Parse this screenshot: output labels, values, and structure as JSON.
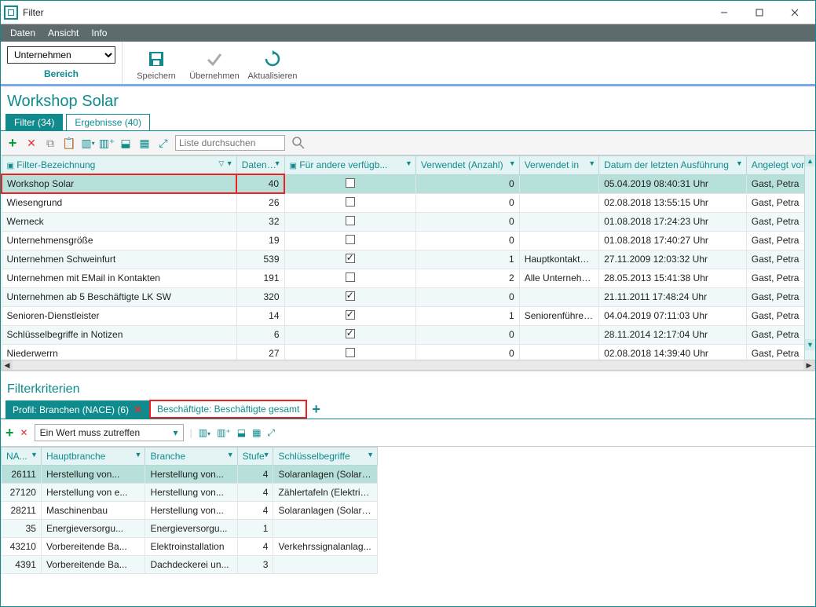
{
  "window": {
    "title": "Filter"
  },
  "menubar": {
    "items": [
      "Daten",
      "Ansicht",
      "Info"
    ]
  },
  "toolbar": {
    "area_selected": "Unternehmen",
    "area_label": "Bereich",
    "buttons": {
      "save": "Speichern",
      "apply": "Übernehmen",
      "refresh": "Aktualisieren"
    }
  },
  "page_title": "Workshop Solar",
  "tabs": {
    "filter": "Filter (34)",
    "results": "Ergebnisse (40)"
  },
  "list_toolbar": {
    "search_placeholder": "Liste durchsuchen"
  },
  "grid": {
    "columns": {
      "name": "Filter-Bezeichnung",
      "datasets": "Datensät...",
      "share": "Für andere verfügb...",
      "used_count": "Verwendet (Anzahl)",
      "used_in": "Verwendet in",
      "last_run": "Datum der letzten Ausführung",
      "created_by": "Angelegt von"
    },
    "rows": [
      {
        "name": "Workshop Solar",
        "count": "40",
        "share": false,
        "used": "0",
        "used_in": "",
        "date": "05.04.2019 08:40:31 Uhr",
        "by": "Gast, Petra",
        "selected": true,
        "highlight": true
      },
      {
        "name": "Wiesengrund",
        "count": "26",
        "share": false,
        "used": "0",
        "used_in": "",
        "date": "02.08.2018 13:55:15 Uhr",
        "by": "Gast, Petra"
      },
      {
        "name": "Werneck",
        "count": "32",
        "share": false,
        "used": "0",
        "used_in": "",
        "date": "01.08.2018 17:24:23 Uhr",
        "by": "Gast, Petra"
      },
      {
        "name": "Unternehmensgröße",
        "count": "19",
        "share": false,
        "used": "0",
        "used_in": "",
        "date": "01.08.2018 17:40:27 Uhr",
        "by": "Gast, Petra"
      },
      {
        "name": "Unternehmen Schweinfurt",
        "count": "539",
        "share": true,
        "used": "1",
        "used_in": "Hauptkontakte S...",
        "date": "27.11.2009 12:03:32 Uhr",
        "by": "Gast, Petra"
      },
      {
        "name": "Unternehmen mit EMail in Kontakten",
        "count": "191",
        "share": false,
        "used": "2",
        "used_in": "Alle Unternehme...",
        "date": "28.05.2013 15:41:38 Uhr",
        "by": "Gast, Petra"
      },
      {
        "name": "Unternehmen ab 5 Beschäftigte LK SW",
        "count": "320",
        "share": true,
        "used": "0",
        "used_in": "",
        "date": "21.11.2011 17:48:24 Uhr",
        "by": "Gast, Petra"
      },
      {
        "name": "Senioren-Dienstleister",
        "count": "14",
        "share": true,
        "used": "1",
        "used_in": "Seniorenführer -...",
        "date": "04.04.2019 07:11:03 Uhr",
        "by": "Gast, Petra"
      },
      {
        "name": "Schlüsselbegriffe in Notizen",
        "count": "6",
        "share": true,
        "used": "0",
        "used_in": "",
        "date": "28.11.2014 12:17:04 Uhr",
        "by": "Gast, Petra"
      },
      {
        "name": "Niederwerrn",
        "count": "27",
        "share": false,
        "used": "0",
        "used_in": "",
        "date": "02.08.2018 14:39:40 Uhr",
        "by": "Gast, Petra"
      }
    ]
  },
  "criteria": {
    "section_title": "Filterkriterien",
    "tabs": {
      "active": "Profil: Branchen (NACE) (6)",
      "other": "Beschäftigte: Beschäftigte gesamt"
    },
    "match_mode": "Ein Wert muss zutreffen",
    "columns": {
      "nace": "NA...",
      "haupt": "Hauptbranche",
      "branche": "Branche",
      "stufe": "Stufe",
      "keys": "Schlüsselbegriffe"
    },
    "rows": [
      {
        "nace": "26111",
        "haupt": "Herstellung von...",
        "branche": "Herstellung von...",
        "stufe": "4",
        "keys": "Solaranlagen (Solarz...",
        "selected": true
      },
      {
        "nace": "27120",
        "haupt": "Herstellung von e...",
        "branche": "Herstellung von...",
        "stufe": "4",
        "keys": "Zählertafeln (Elektriz..."
      },
      {
        "nace": "28211",
        "haupt": "Maschinenbau",
        "branche": "Herstellung von...",
        "stufe": "4",
        "keys": "Solaranlagen (Solark..."
      },
      {
        "nace": "35",
        "haupt": "Energieversorgu...",
        "branche": "Energieversorgu...",
        "stufe": "1",
        "keys": ""
      },
      {
        "nace": "43210",
        "haupt": "Vorbereitende Ba...",
        "branche": "Elektroinstallation",
        "stufe": "4",
        "keys": "Verkehrssignalanlag..."
      },
      {
        "nace": "4391",
        "haupt": "Vorbereitende Ba...",
        "branche": "Dachdeckerei un...",
        "stufe": "3",
        "keys": ""
      }
    ]
  }
}
